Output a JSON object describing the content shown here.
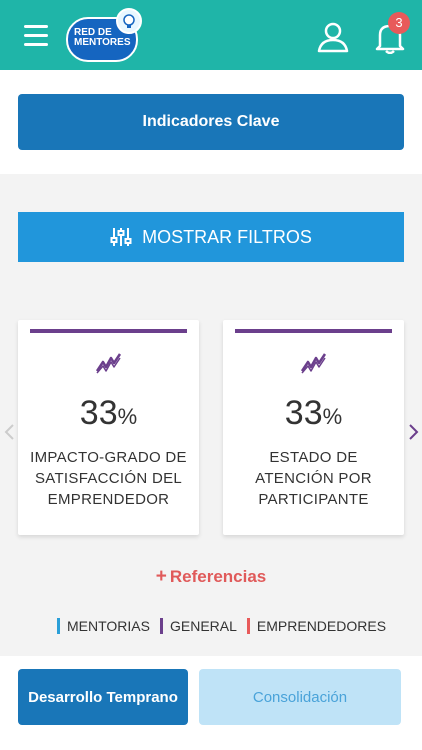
{
  "header": {
    "logo_text": "RED DE MENTORES",
    "notification_count": "3",
    "background_color": "#1fb5a8"
  },
  "key_indicators_label": "Indicadores Clave",
  "filters_label": "MOSTRAR FILTROS",
  "cards": [
    {
      "value": "33",
      "unit": "%",
      "label": "IMPACTO-GRADO DE SATISFACCIÓN DEL EMPRENDEDOR",
      "icon": "trend-up-icon"
    },
    {
      "value": "33",
      "unit": "%",
      "label": "ESTADO DE ATENCIÓN POR PARTICIPANTE",
      "icon": "trend-up-icon"
    }
  ],
  "references_label": "Referencias",
  "legend": [
    {
      "label": "MENTORIAS",
      "color": "#2a9fd8"
    },
    {
      "label": "GENERAL",
      "color": "#6b3f8c"
    },
    {
      "label": "EMPRENDEDORES",
      "color": "#e85a5a"
    }
  ],
  "bottom_tabs": {
    "active": "Desarrollo Temprano",
    "inactive": "Consolidación"
  }
}
